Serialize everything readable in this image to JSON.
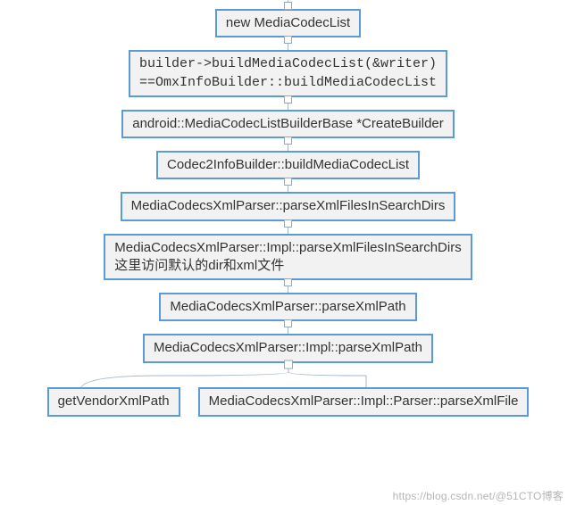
{
  "diagram": {
    "nodes": [
      "new MediaCodecList",
      "builder->buildMediaCodecList(&writer)\n==OmxInfoBuilder::buildMediaCodecList",
      "android::MediaCodecListBuilderBase *CreateBuilder",
      "Codec2InfoBuilder::buildMediaCodecList",
      "MediaCodecsXmlParser::parseXmlFilesInSearchDirs",
      "MediaCodecsXmlParser::Impl::parseXmlFilesInSearchDirs\n这里访问默认的dir和xml文件",
      "MediaCodecsXmlParser::parseXmlPath",
      "MediaCodecsXmlParser::Impl::parseXmlPath"
    ],
    "fork": {
      "left": "getVendorXmlPath",
      "right": "MediaCodecsXmlParser::Impl::Parser::parseXmlFile"
    }
  },
  "watermark": "https://blog.csdn.net/@51CTO博客"
}
